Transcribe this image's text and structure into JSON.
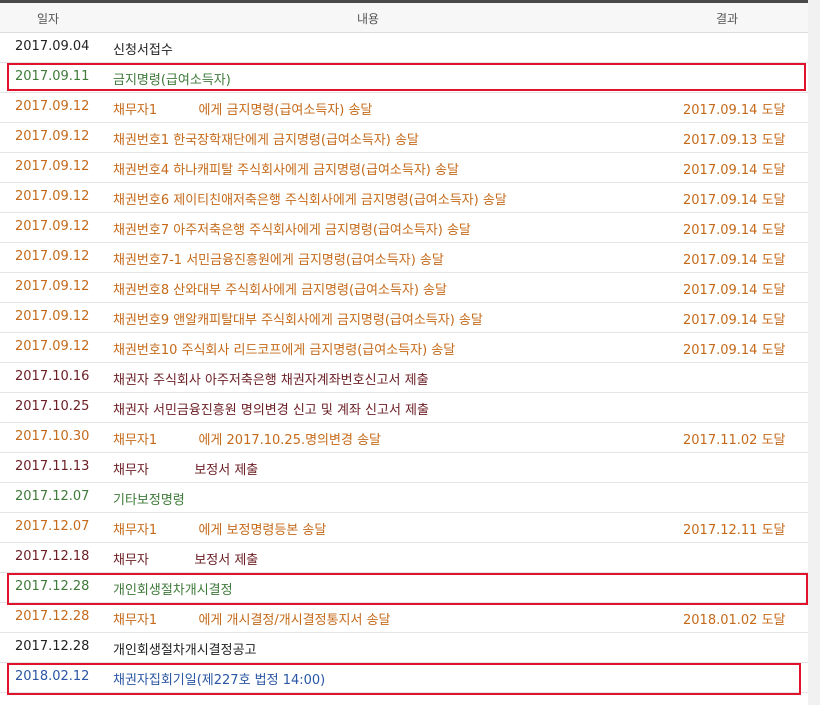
{
  "headers": {
    "date": "일자",
    "content": "내용",
    "result": "결과"
  },
  "rows": [
    {
      "date": "2017.09.04",
      "content": "신청서접수",
      "result": "",
      "color": "black"
    },
    {
      "date": "2017.09.11",
      "content": "금지명령(급여소득자)",
      "result": "",
      "color": "green"
    },
    {
      "date": "2017.09.12",
      "content": "채무자1          에게 금지명령(급여소득자) 송달",
      "result": "2017.09.14 도달",
      "color": "orange"
    },
    {
      "date": "2017.09.12",
      "content": "채권번호1 한국장학재단에게 금지명령(급여소득자) 송달",
      "result": "2017.09.13 도달",
      "color": "orange"
    },
    {
      "date": "2017.09.12",
      "content": "채권번호4 하나캐피탈 주식회사에게 금지명령(급여소득자) 송달",
      "result": "2017.09.14 도달",
      "color": "orange"
    },
    {
      "date": "2017.09.12",
      "content": "채권번호6 제이티친애저축은행 주식회사에게 금지명령(급여소득자) 송달",
      "result": "2017.09.14 도달",
      "color": "orange"
    },
    {
      "date": "2017.09.12",
      "content": "채권번호7 아주저축은행 주식회사에게 금지명령(급여소득자) 송달",
      "result": "2017.09.14 도달",
      "color": "orange"
    },
    {
      "date": "2017.09.12",
      "content": "채권번호7-1 서민금융진흥원에게 금지명령(급여소득자) 송달",
      "result": "2017.09.14 도달",
      "color": "orange"
    },
    {
      "date": "2017.09.12",
      "content": "채권번호8 산와대부 주식회사에게 금지명령(급여소득자) 송달",
      "result": "2017.09.14 도달",
      "color": "orange"
    },
    {
      "date": "2017.09.12",
      "content": "채권번호9 앤알캐피탈대부 주식회사에게 금지명령(급여소득자) 송달",
      "result": "2017.09.14 도달",
      "color": "orange"
    },
    {
      "date": "2017.09.12",
      "content": "채권번호10 주식회사 리드코프에게 금지명령(급여소득자) 송달",
      "result": "2017.09.14 도달",
      "color": "orange"
    },
    {
      "date": "2017.10.16",
      "content": "채권자 주식회사 아주저축은행 채권자계좌번호신고서 제출",
      "result": "",
      "color": "maroon"
    },
    {
      "date": "2017.10.25",
      "content": "채권자 서민금융진흥원 명의변경 신고 및 계좌 신고서 제출",
      "result": "",
      "color": "maroon"
    },
    {
      "date": "2017.10.30",
      "content": "채무자1          에게 2017.10.25.명의변경 송달",
      "result": "2017.11.02 도달",
      "color": "orange"
    },
    {
      "date": "2017.11.13",
      "content": "채무자           보정서 제출",
      "result": "",
      "color": "maroon"
    },
    {
      "date": "2017.12.07",
      "content": "기타보정명령",
      "result": "",
      "color": "green"
    },
    {
      "date": "2017.12.07",
      "content": "채무자1          에게 보정명령등본 송달",
      "result": "2017.12.11 도달",
      "color": "orange"
    },
    {
      "date": "2017.12.18",
      "content": "채무자           보정서 제출",
      "result": "",
      "color": "maroon"
    },
    {
      "date": "2017.12.28",
      "content": "개인회생절차개시결정",
      "result": "",
      "color": "green"
    },
    {
      "date": "2017.12.28",
      "content": "채무자1          에게 개시결정/개시결정통지서 송달",
      "result": "2018.01.02 도달",
      "color": "orange"
    },
    {
      "date": "2017.12.28",
      "content": "개인회생절차개시결정공고",
      "result": "",
      "color": "black"
    },
    {
      "date": "2018.02.12",
      "content": "채권자집회기일(제227호 법정 14:00)",
      "result": "",
      "color": "blue"
    }
  ],
  "colors": {
    "black": "#222222",
    "orange": "#c56a1b",
    "green": "#3f7a3a",
    "blue": "#2a56a3",
    "maroon": "#6b1e24",
    "highlight": "#e1122b"
  }
}
